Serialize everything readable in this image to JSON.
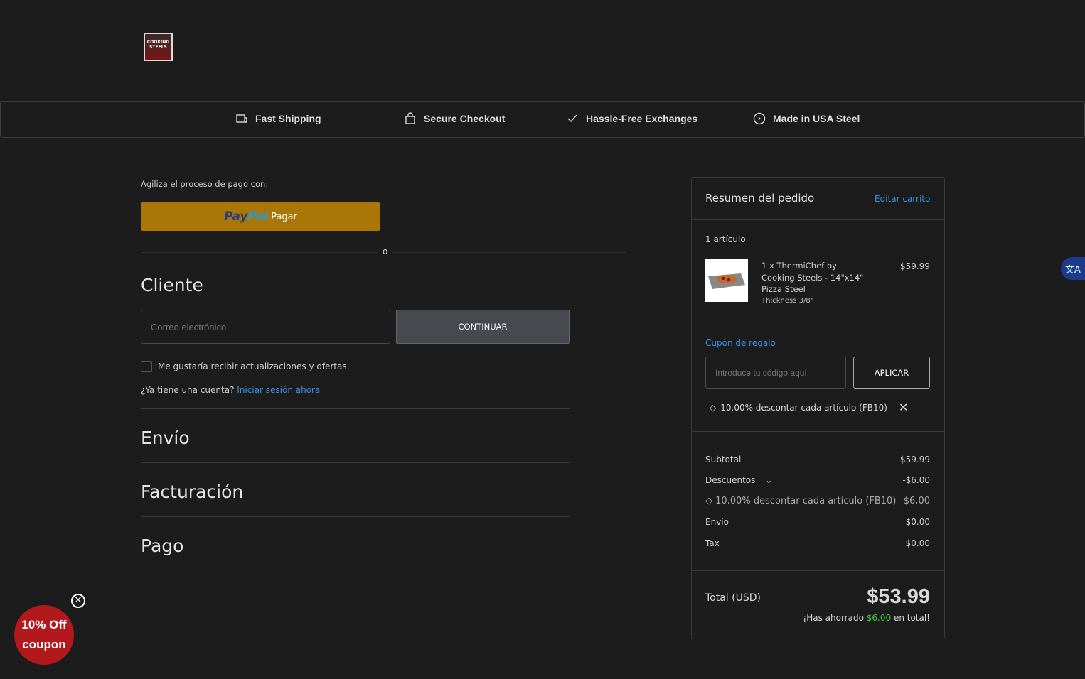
{
  "logo_text": "COOKING STEELS",
  "features": [
    {
      "icon": "truck-icon",
      "label": "Fast Shipping"
    },
    {
      "icon": "bag-icon",
      "label": "Secure Checkout"
    },
    {
      "icon": "check-icon",
      "label": "Hassle-Free Exchanges"
    },
    {
      "icon": "circle-arrow-icon",
      "label": "Made in USA Steel"
    }
  ],
  "express": {
    "label": "Agiliza el proceso de pago con:",
    "paypal_a": "Pay",
    "paypal_b": "Pal",
    "paypal_label": "Pagar",
    "or": "o"
  },
  "customer": {
    "title": "Cliente",
    "email_placeholder": "Correo electrónico",
    "continue": "CONTINUAR",
    "newsletter": "Me gustaría recibir actualizaciones y ofertas.",
    "account_q": "¿Ya tiene una cuenta?",
    "login": "Iniciar sesión ahora"
  },
  "steps": [
    "Envío",
    "Facturación",
    "Pago"
  ],
  "summary": {
    "title": "Resumen del pedido",
    "edit": "Editar carrito",
    "count": "1 artículo",
    "item": {
      "name_lines": [
        "1 x ThermiChef by",
        "Cooking Steels - 14\"x14\"",
        "Pizza Steel"
      ],
      "option": "Thickness 3/8\"",
      "price": "$59.99"
    },
    "coupon_title": "Cupón de regalo",
    "coupon_placeholder": "Introduce tu código aquí",
    "apply": "APLICAR",
    "applied": "10.00% descontar cada artículo (FB10)",
    "rows": {
      "subtotal_l": "Subtotal",
      "subtotal_v": "$59.99",
      "disc_l": "Descuentos",
      "disc_v": "-$6.00",
      "disc_item_l": "10.00% descontar cada artículo (FB10)",
      "disc_item_v": "-$6.00",
      "ship_l": "Envío",
      "ship_v": "$0.00",
      "tax_l": "Tax",
      "tax_v": "$0.00"
    },
    "total_l": "Total (USD)",
    "total_v": "$53.99",
    "saved_a": "¡Has ahorrado",
    "saved_v": "$6.00",
    "saved_b": "en total!"
  },
  "coupon_popup": {
    "line1": "10% Off",
    "line2": "coupon"
  },
  "translate_icon": "文A"
}
